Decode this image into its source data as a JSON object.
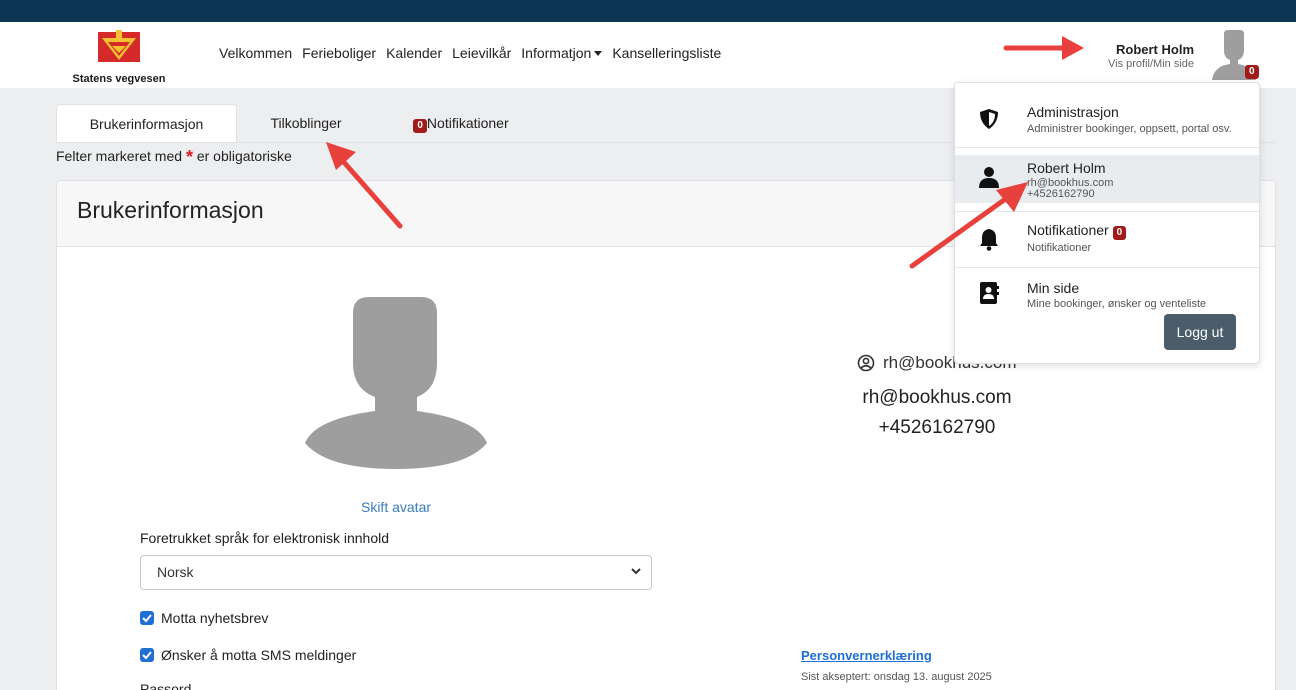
{
  "brand": {
    "name": "Statens vegvesen",
    "accent": "#0b3553"
  },
  "nav": {
    "items": [
      "Velkommen",
      "Ferieboliger",
      "Kalender",
      "Leievilkår",
      "Informatjon",
      "Kanselleringsliste"
    ]
  },
  "user": {
    "name": "Robert Holm",
    "subtitle": "Vis profil/Min side",
    "badge": "0"
  },
  "tabs": [
    {
      "label": "Brukerinformasjon",
      "active": true
    },
    {
      "label": "Tilkoblinger",
      "active": false
    },
    {
      "label": "Notifikationer",
      "badge": "0",
      "active": false
    }
  ],
  "form": {
    "required_note_pre": "Felter markeret med",
    "required_star": "*",
    "required_note_post": "er obligatoriske",
    "card_title": "Brukerinformasjon",
    "change_avatar": "Skift avatar",
    "language_label": "Foretrukket språk for elektronisk innhold",
    "language_value": "Norsk",
    "newsletter_label": "Motta nyhetsbrev",
    "newsletter_checked": true,
    "sms_label": "Ønsker å motta SMS meldinger",
    "sms_checked": true,
    "password_label": "Passord"
  },
  "contact": {
    "username": "rh@bookhus.com",
    "email": "rh@bookhus.com",
    "phone": "+4526162790"
  },
  "privacy": {
    "link": "Personvernerklæring",
    "accepted": "Sist akseptert: onsdag 13. august 2025"
  },
  "dropdown": {
    "admin_title": "Administrasjon",
    "admin_sub": "Administrer bookinger, oppsett, portal osv.",
    "profile_name": "Robert Holm",
    "profile_email": "rh@bookhus.com",
    "profile_phone": "+4526162790",
    "notif_title": "Notifikationer",
    "notif_badge": "0",
    "notif_sub": "Notifikationer",
    "minside_title": "Min side",
    "minside_sub": "Mine bookinger, ønsker og venteliste",
    "logout": "Logg ut"
  },
  "icons": {
    "admin": "shield-icon",
    "profile": "user-icon",
    "notifications": "bell-icon",
    "minside": "address-book-icon",
    "username": "user-circle-icon"
  }
}
